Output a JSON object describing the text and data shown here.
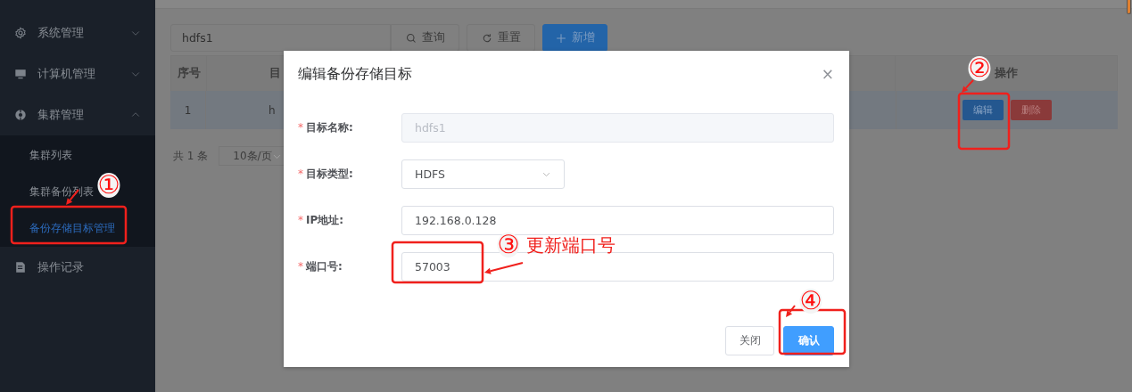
{
  "sidebar": {
    "items": [
      {
        "label": "系统管理",
        "kind": "group",
        "expanded": false
      },
      {
        "label": "计算机管理",
        "kind": "group",
        "expanded": false
      },
      {
        "label": "集群管理",
        "kind": "group",
        "expanded": true,
        "children": [
          {
            "label": "集群列表",
            "selected": false
          },
          {
            "label": "集群备份列表",
            "selected": false
          },
          {
            "label": "备份存储目标管理",
            "selected": true
          }
        ]
      },
      {
        "label": "操作记录",
        "kind": "link"
      }
    ]
  },
  "toolbar": {
    "search": {
      "value": "hdfs1"
    },
    "buttons": [
      {
        "label": "查询",
        "kind": "plain"
      },
      {
        "label": "重置",
        "kind": "plain"
      },
      {
        "label": "新增",
        "kind": "primary"
      }
    ]
  },
  "table": {
    "columns": [
      {
        "label": "序号",
        "kind": "index"
      },
      {
        "label": "目",
        "kind": "name"
      },
      {
        "label": "操作",
        "kind": "actions"
      }
    ],
    "rows": [
      {
        "selected": true,
        "cells": [
          "1",
          "h"
        ],
        "actions": [
          {
            "label": "编辑",
            "kind": "edit"
          },
          {
            "label": "删除",
            "kind": "delete"
          }
        ]
      }
    ]
  },
  "pagination": {
    "total": "共 1 条",
    "page_size": "10条/页"
  },
  "dialog": {
    "title": "编辑备份存储目标",
    "close": "×",
    "fields": [
      {
        "mark": "*",
        "label": "目标名称:",
        "kind": "input",
        "value": "hdfs1",
        "disabled": true
      },
      {
        "mark": "*",
        "label": "目标类型:",
        "kind": "select",
        "value": "HDFS",
        "disabled": false
      },
      {
        "mark": "*",
        "label": "IP地址:",
        "kind": "input",
        "value": "192.168.0.128",
        "disabled": false
      },
      {
        "mark": "*",
        "label": "端口号:",
        "kind": "input",
        "value": "57003",
        "disabled": false
      }
    ],
    "buttons": [
      {
        "label": "关闭",
        "kind": "plain"
      },
      {
        "label": "确认",
        "kind": "primary"
      }
    ]
  },
  "annotations": [
    {
      "marker": "①"
    },
    {
      "marker": "②"
    },
    {
      "marker": "③",
      "note": "更新端口号"
    },
    {
      "marker": "④"
    }
  ]
}
